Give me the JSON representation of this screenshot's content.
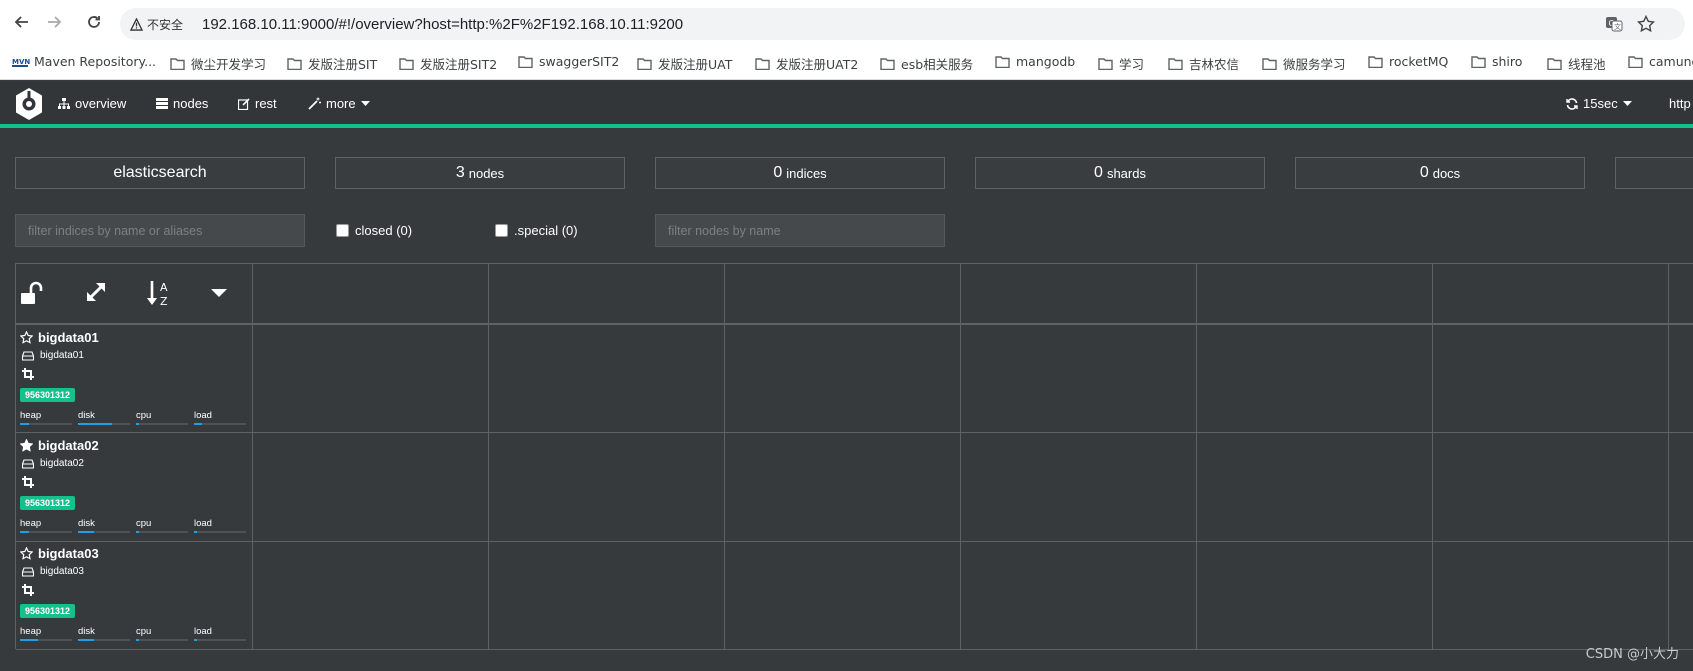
{
  "browser": {
    "security_label": "不安全",
    "url": "192.168.10.11:9000/#!/overview?host=http:%2F%2F192.168.10.11:9200",
    "bookmarks": [
      {
        "label": "Maven Repository...",
        "icon": "maven-icon"
      },
      {
        "label": "微尘开发学习",
        "icon": "folder-icon"
      },
      {
        "label": "发版注册SIT",
        "icon": "folder-icon"
      },
      {
        "label": "发版注册SIT2",
        "icon": "folder-icon"
      },
      {
        "label": "swaggerSIT2",
        "icon": "folder-icon"
      },
      {
        "label": "发版注册UAT",
        "icon": "folder-icon"
      },
      {
        "label": "发版注册UAT2",
        "icon": "folder-icon"
      },
      {
        "label": "esb相关服务",
        "icon": "folder-icon"
      },
      {
        "label": "mangodb",
        "icon": "folder-icon"
      },
      {
        "label": "学习",
        "icon": "folder-icon"
      },
      {
        "label": "吉林农信",
        "icon": "folder-icon"
      },
      {
        "label": "微服务学习",
        "icon": "folder-icon"
      },
      {
        "label": "rocketMQ",
        "icon": "folder-icon"
      },
      {
        "label": "shiro",
        "icon": "folder-icon"
      },
      {
        "label": "线程池",
        "icon": "folder-icon"
      },
      {
        "label": "camund",
        "icon": "folder-icon"
      }
    ]
  },
  "app_nav": {
    "overview": "overview",
    "nodes": "nodes",
    "rest": "rest",
    "more": "more",
    "refresh": "15sec",
    "host": "http"
  },
  "stats": {
    "cluster_name": "elasticsearch",
    "nodes_count": "3",
    "nodes_label": "nodes",
    "indices_count": "0",
    "indices_label": "indices",
    "shards_count": "0",
    "shards_label": "shards",
    "docs_count": "0",
    "docs_label": "docs"
  },
  "filters": {
    "indices_placeholder": "filter indices by name or aliases",
    "closed_label": "closed (0)",
    "special_label": ".special (0)",
    "nodes_placeholder": "filter nodes by name"
  },
  "nodes": [
    {
      "name": "bigdata01",
      "host": "bigdata01",
      "id": "956301312",
      "master": false,
      "metric_labels": [
        "heap",
        "disk",
        "cpu",
        "load"
      ],
      "levels": [
        0.18,
        0.65,
        0.05,
        0.15
      ]
    },
    {
      "name": "bigdata02",
      "host": "bigdata02",
      "id": "956301312",
      "master": true,
      "metric_labels": [
        "heap",
        "disk",
        "cpu",
        "load"
      ],
      "levels": [
        0.18,
        0.3,
        0.05,
        0.05
      ]
    },
    {
      "name": "bigdata03",
      "host": "bigdata03",
      "id": "956301312",
      "master": false,
      "metric_labels": [
        "heap",
        "disk",
        "cpu",
        "load"
      ],
      "levels": [
        0.35,
        0.3,
        0.05,
        0.05
      ]
    }
  ],
  "colors": {
    "accent": "#14c08b",
    "bar": "#1e9fe8",
    "background": "#363a3d"
  },
  "watermark": "CSDN @小大力"
}
